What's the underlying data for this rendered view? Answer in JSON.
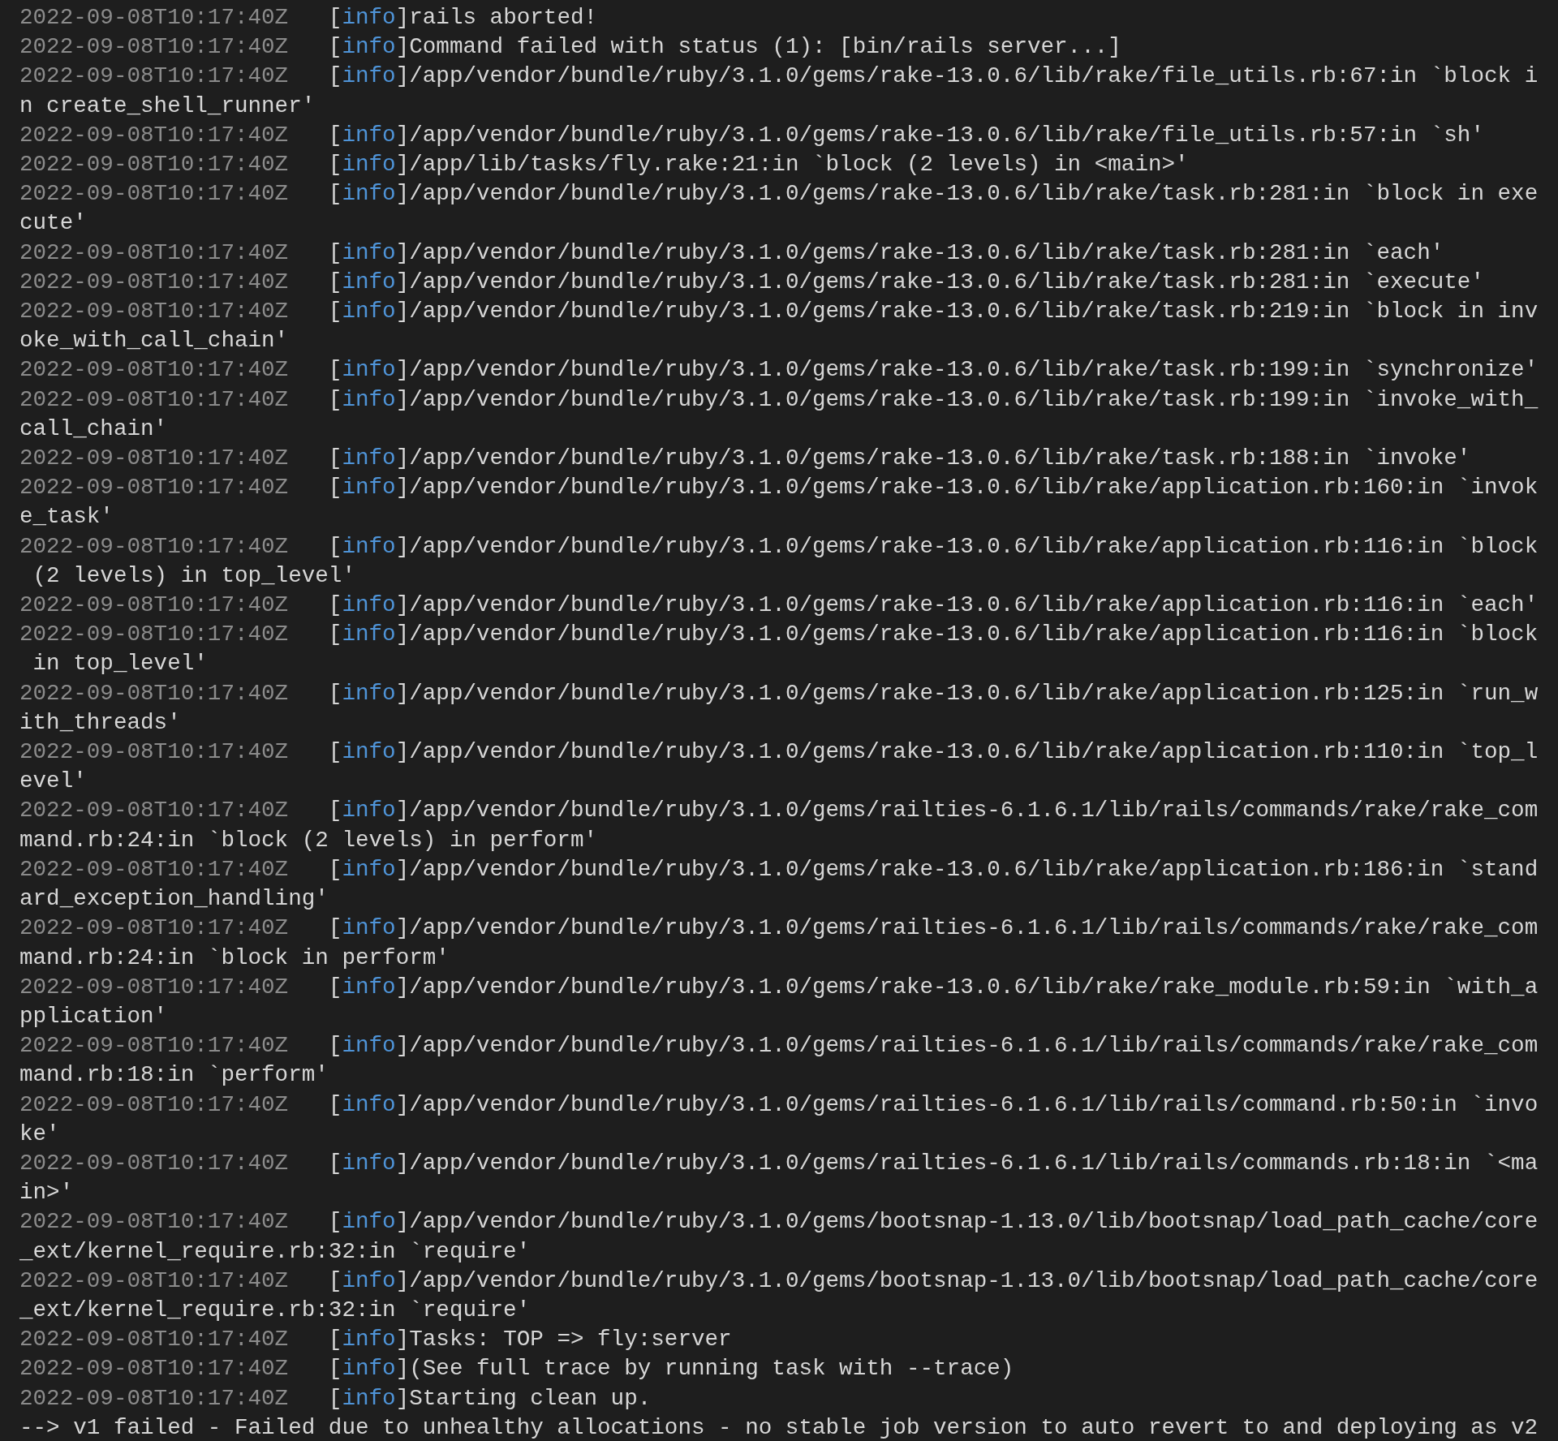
{
  "log_lines": [
    {
      "kind": "log",
      "timestamp": "2022-09-08T10:17:40Z",
      "tag": "[info]",
      "message": "rails aborted!"
    },
    {
      "kind": "log",
      "timestamp": "2022-09-08T10:17:40Z",
      "tag": "[info]",
      "message": "Command failed with status (1): [bin/rails server...]"
    },
    {
      "kind": "log",
      "timestamp": "2022-09-08T10:17:40Z",
      "tag": "[info]",
      "message": "/app/vendor/bundle/ruby/3.1.0/gems/rake-13.0.6/lib/rake/file_utils.rb:67:in `block in create_shell_runner'"
    },
    {
      "kind": "log",
      "timestamp": "2022-09-08T10:17:40Z",
      "tag": "[info]",
      "message": "/app/vendor/bundle/ruby/3.1.0/gems/rake-13.0.6/lib/rake/file_utils.rb:57:in `sh'"
    },
    {
      "kind": "log",
      "timestamp": "2022-09-08T10:17:40Z",
      "tag": "[info]",
      "message": "/app/lib/tasks/fly.rake:21:in `block (2 levels) in <main>'"
    },
    {
      "kind": "log",
      "timestamp": "2022-09-08T10:17:40Z",
      "tag": "[info]",
      "message": "/app/vendor/bundle/ruby/3.1.0/gems/rake-13.0.6/lib/rake/task.rb:281:in `block in execute'"
    },
    {
      "kind": "log",
      "timestamp": "2022-09-08T10:17:40Z",
      "tag": "[info]",
      "message": "/app/vendor/bundle/ruby/3.1.0/gems/rake-13.0.6/lib/rake/task.rb:281:in `each'"
    },
    {
      "kind": "log",
      "timestamp": "2022-09-08T10:17:40Z",
      "tag": "[info]",
      "message": "/app/vendor/bundle/ruby/3.1.0/gems/rake-13.0.6/lib/rake/task.rb:281:in `execute'"
    },
    {
      "kind": "log",
      "timestamp": "2022-09-08T10:17:40Z",
      "tag": "[info]",
      "message": "/app/vendor/bundle/ruby/3.1.0/gems/rake-13.0.6/lib/rake/task.rb:219:in `block in invoke_with_call_chain'"
    },
    {
      "kind": "log",
      "timestamp": "2022-09-08T10:17:40Z",
      "tag": "[info]",
      "message": "/app/vendor/bundle/ruby/3.1.0/gems/rake-13.0.6/lib/rake/task.rb:199:in `synchronize'"
    },
    {
      "kind": "log",
      "timestamp": "2022-09-08T10:17:40Z",
      "tag": "[info]",
      "message": "/app/vendor/bundle/ruby/3.1.0/gems/rake-13.0.6/lib/rake/task.rb:199:in `invoke_with_call_chain'"
    },
    {
      "kind": "log",
      "timestamp": "2022-09-08T10:17:40Z",
      "tag": "[info]",
      "message": "/app/vendor/bundle/ruby/3.1.0/gems/rake-13.0.6/lib/rake/task.rb:188:in `invoke'"
    },
    {
      "kind": "log",
      "timestamp": "2022-09-08T10:17:40Z",
      "tag": "[info]",
      "message": "/app/vendor/bundle/ruby/3.1.0/gems/rake-13.0.6/lib/rake/application.rb:160:in `invoke_task'"
    },
    {
      "kind": "log",
      "timestamp": "2022-09-08T10:17:40Z",
      "tag": "[info]",
      "message": "/app/vendor/bundle/ruby/3.1.0/gems/rake-13.0.6/lib/rake/application.rb:116:in `block (2 levels) in top_level'"
    },
    {
      "kind": "log",
      "timestamp": "2022-09-08T10:17:40Z",
      "tag": "[info]",
      "message": "/app/vendor/bundle/ruby/3.1.0/gems/rake-13.0.6/lib/rake/application.rb:116:in `each'"
    },
    {
      "kind": "log",
      "timestamp": "2022-09-08T10:17:40Z",
      "tag": "[info]",
      "message": "/app/vendor/bundle/ruby/3.1.0/gems/rake-13.0.6/lib/rake/application.rb:116:in `block in top_level'"
    },
    {
      "kind": "log",
      "timestamp": "2022-09-08T10:17:40Z",
      "tag": "[info]",
      "message": "/app/vendor/bundle/ruby/3.1.0/gems/rake-13.0.6/lib/rake/application.rb:125:in `run_with_threads'"
    },
    {
      "kind": "log",
      "timestamp": "2022-09-08T10:17:40Z",
      "tag": "[info]",
      "message": "/app/vendor/bundle/ruby/3.1.0/gems/rake-13.0.6/lib/rake/application.rb:110:in `top_level'"
    },
    {
      "kind": "log",
      "timestamp": "2022-09-08T10:17:40Z",
      "tag": "[info]",
      "message": "/app/vendor/bundle/ruby/3.1.0/gems/railties-6.1.6.1/lib/rails/commands/rake/rake_command.rb:24:in `block (2 levels) in perform'"
    },
    {
      "kind": "log",
      "timestamp": "2022-09-08T10:17:40Z",
      "tag": "[info]",
      "message": "/app/vendor/bundle/ruby/3.1.0/gems/rake-13.0.6/lib/rake/application.rb:186:in `standard_exception_handling'"
    },
    {
      "kind": "log",
      "timestamp": "2022-09-08T10:17:40Z",
      "tag": "[info]",
      "message": "/app/vendor/bundle/ruby/3.1.0/gems/railties-6.1.6.1/lib/rails/commands/rake/rake_command.rb:24:in `block in perform'"
    },
    {
      "kind": "log",
      "timestamp": "2022-09-08T10:17:40Z",
      "tag": "[info]",
      "message": "/app/vendor/bundle/ruby/3.1.0/gems/rake-13.0.6/lib/rake/rake_module.rb:59:in `with_application'"
    },
    {
      "kind": "log",
      "timestamp": "2022-09-08T10:17:40Z",
      "tag": "[info]",
      "message": "/app/vendor/bundle/ruby/3.1.0/gems/railties-6.1.6.1/lib/rails/commands/rake/rake_command.rb:18:in `perform'"
    },
    {
      "kind": "log",
      "timestamp": "2022-09-08T10:17:40Z",
      "tag": "[info]",
      "message": "/app/vendor/bundle/ruby/3.1.0/gems/railties-6.1.6.1/lib/rails/command.rb:50:in `invoke'"
    },
    {
      "kind": "log",
      "timestamp": "2022-09-08T10:17:40Z",
      "tag": "[info]",
      "message": "/app/vendor/bundle/ruby/3.1.0/gems/railties-6.1.6.1/lib/rails/commands.rb:18:in `<main>'"
    },
    {
      "kind": "log",
      "timestamp": "2022-09-08T10:17:40Z",
      "tag": "[info]",
      "message": "/app/vendor/bundle/ruby/3.1.0/gems/bootsnap-1.13.0/lib/bootsnap/load_path_cache/core_ext/kernel_require.rb:32:in `require'"
    },
    {
      "kind": "log",
      "timestamp": "2022-09-08T10:17:40Z",
      "tag": "[info]",
      "message": "/app/vendor/bundle/ruby/3.1.0/gems/bootsnap-1.13.0/lib/bootsnap/load_path_cache/core_ext/kernel_require.rb:32:in `require'"
    },
    {
      "kind": "log",
      "timestamp": "2022-09-08T10:17:40Z",
      "tag": "[info]",
      "message": "Tasks: TOP => fly:server"
    },
    {
      "kind": "log",
      "timestamp": "2022-09-08T10:17:40Z",
      "tag": "[info]",
      "message": "(See full trace by running task with --trace)"
    },
    {
      "kind": "log",
      "timestamp": "2022-09-08T10:17:40Z",
      "tag": "[info]",
      "message": "Starting clean up."
    },
    {
      "kind": "status",
      "message": "--> v1 failed - Failed due to unhealthy allocations - no stable job version to auto revert to and deploying as v2"
    }
  ]
}
